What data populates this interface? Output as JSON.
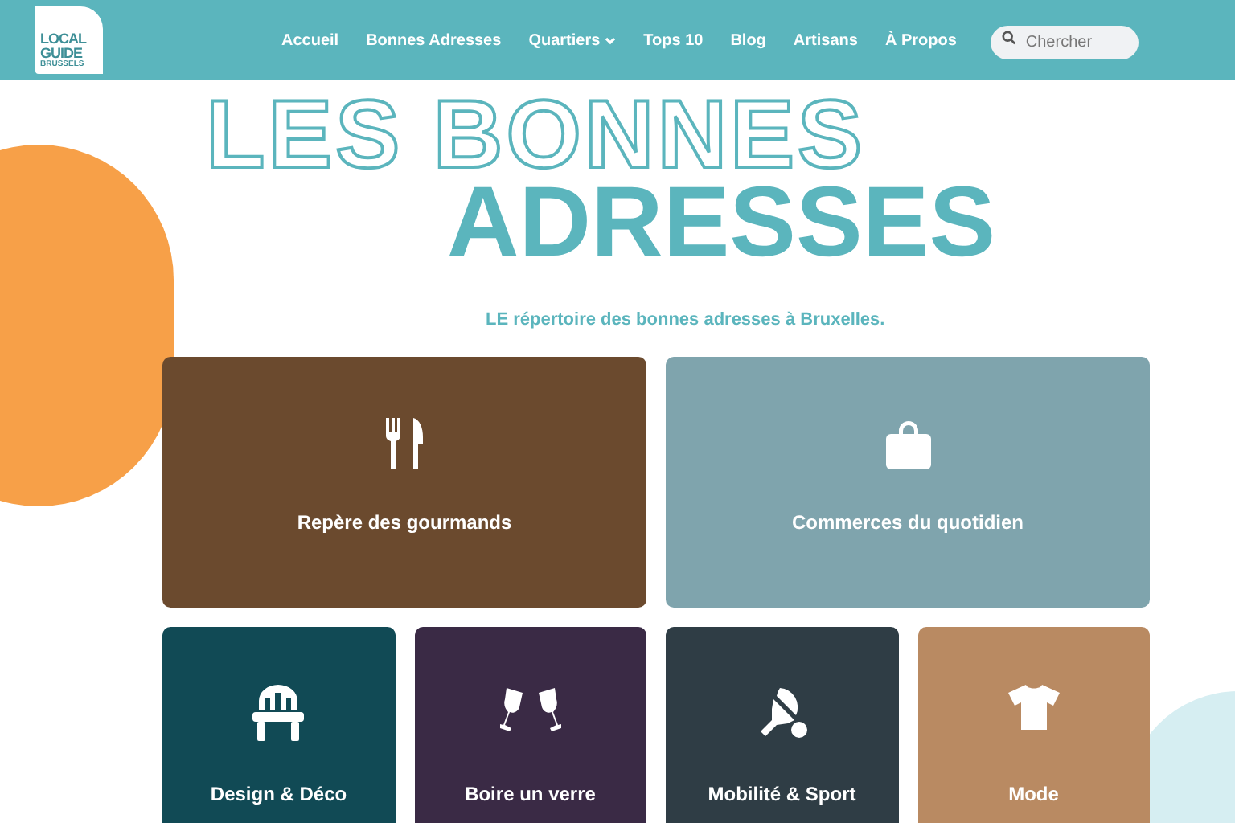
{
  "logo": {
    "lines": [
      "LOCAL",
      "GUIDE",
      "BRUSSELS"
    ]
  },
  "nav": [
    {
      "label": "Accueil",
      "dropdown": false
    },
    {
      "label": "Bonnes Adresses",
      "dropdown": false
    },
    {
      "label": "Quartiers",
      "dropdown": true
    },
    {
      "label": "Tops 10",
      "dropdown": false
    },
    {
      "label": "Blog",
      "dropdown": false
    },
    {
      "label": "Artisans",
      "dropdown": false
    },
    {
      "label": "À Propos",
      "dropdown": false
    }
  ],
  "search": {
    "placeholder": "Chercher"
  },
  "hero": {
    "title_outline": "LES BONNES",
    "title_filled": "ADRESSES",
    "subtitle": "LE répertoire des bonnes adresses à Bruxelles."
  },
  "cards": [
    {
      "label": "Repère des gourmands",
      "color": "#6b4a2e"
    },
    {
      "label": "Commerces du quotidien",
      "color": "#7fa4ad"
    },
    {
      "label": "Design & Déco",
      "color": "#114a55"
    },
    {
      "label": "Boire un verre",
      "color": "#3a2a45"
    },
    {
      "label": "Mobilité & Sport",
      "color": "#2f3d45"
    },
    {
      "label": "Mode",
      "color": "#b98a62"
    }
  ]
}
